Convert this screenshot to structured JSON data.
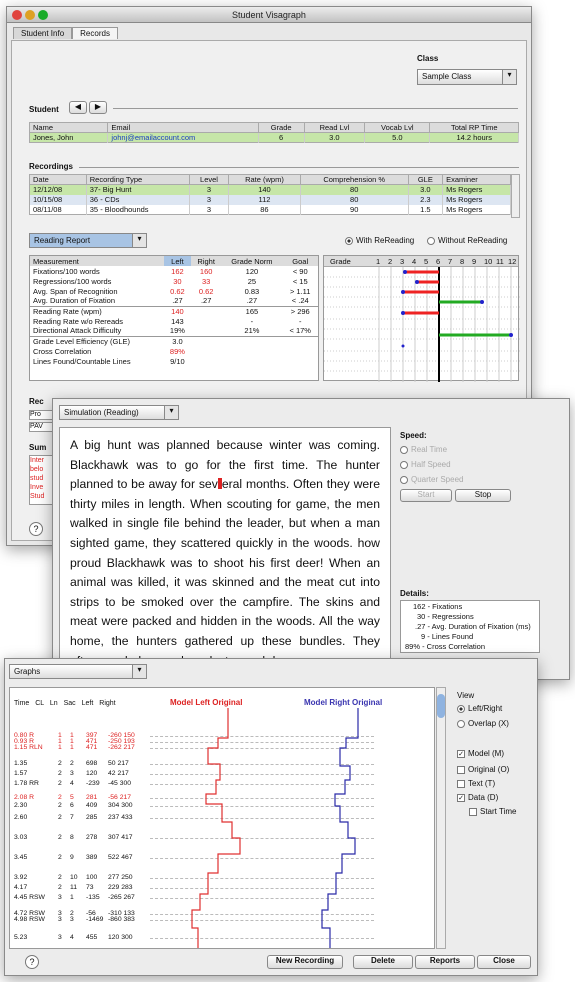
{
  "app": {
    "title": "Student Visagraph",
    "tabs": [
      "Student Info",
      "Records"
    ]
  },
  "class_section": {
    "label": "Class",
    "selected": "Sample Class"
  },
  "student": {
    "label": "Student",
    "headers": [
      "Name",
      "Email",
      "Grade",
      "Read Lvl",
      "Vocab Lvl",
      "Total RP Time"
    ],
    "row": [
      "Jones, John",
      "johnj@emailaccount.com",
      "6",
      "3.0",
      "5.0",
      "14.2 hours"
    ]
  },
  "recordings": {
    "label": "Recordings",
    "headers": [
      "Date",
      "Recording Type",
      "Level",
      "Rate (wpm)",
      "Comprehension %",
      "GLE",
      "Examiner"
    ],
    "rows": [
      [
        "12/12/08",
        "37- Big Hunt",
        "3",
        "140",
        "80",
        "3.0",
        "Ms Rogers"
      ],
      [
        "10/15/08",
        "36 - CDs",
        "3",
        "112",
        "80",
        "2.3",
        "Ms Rogers"
      ],
      [
        "08/11/08",
        "35 - Bloodhounds",
        "3",
        "86",
        "90",
        "1.5",
        "Ms Rogers"
      ]
    ]
  },
  "report": {
    "selected": "Reading Report",
    "with": "With ReReading",
    "without": "Without ReReading",
    "headers": [
      "Measurement",
      "Left",
      "Right",
      "Grade Norm",
      "Goal"
    ],
    "rows": [
      [
        "Fixations/100 words",
        "162",
        "160",
        "120",
        "< 90"
      ],
      [
        "Regressions/100 words",
        "30",
        "33",
        "25",
        "< 15"
      ],
      [
        "Avg. Span of Recognition",
        "0.62",
        "0.62",
        "0.83",
        "> 1.11"
      ],
      [
        "Avg. Duration of Fixation",
        ".27",
        ".27",
        ".27",
        "< .24"
      ]
    ],
    "rows2": [
      [
        "Reading Rate (wpm)",
        "140",
        "",
        "165",
        "> 296"
      ],
      [
        "Reading Rate w/o Rereads",
        "143",
        "",
        "-",
        "-"
      ],
      [
        "Directional Attack Difficulty",
        "19%",
        "",
        "21%",
        "< 17%"
      ]
    ],
    "rows3": [
      [
        "Grade Level Efficiency (GLE)",
        "3.0"
      ],
      [
        "Cross Correlation",
        "89%"
      ],
      [
        "Lines Found/Countable Lines",
        "9/10"
      ]
    ],
    "grade_label": "Grade",
    "grades": [
      "1",
      "2",
      "3",
      "4",
      "5",
      "6",
      "7",
      "8",
      "9",
      "10",
      "11",
      "12"
    ]
  },
  "side_labels": {
    "rec": "Rec",
    "pro": "Pro",
    "pav": "PAV",
    "sum": "Sum",
    "sum_lines": [
      "Inter",
      "belo",
      "stud",
      "Inve",
      "Stud"
    ]
  },
  "simulation": {
    "selected": "Simulation (Reading)",
    "text_before": "A big hunt was planned because winter was coming. Blackhawk was to go for the first time. The hunter planned to be away for sev",
    "text_after": "eral months. Often they were thirty miles in length. When scouting for game, the men walked in single file behind the leader, but when a man sighted game, they scattered quickly in the woods. how proud Blackhawk was to shoot his first deer! When an animal was killed, it was skinned and the meat cut into strips to be smoked over the campfire. The skins and meat were packed and hidden in the woods. All the way home, the hunters gathered up these bundles. They often needed several weeks to reach home.",
    "speed_label": "Speed:",
    "speeds": [
      "Real Time",
      "Half Speed",
      "Quarter Speed"
    ],
    "start": "Start",
    "stop": "Stop",
    "details_label": "Details:",
    "details": [
      "162 - Fixations",
      "30 - Regressions",
      ".27 - Avg. Duration of Fixation (ms)",
      "9 - Lines Found",
      "89% - Cross Correlation"
    ]
  },
  "graphs": {
    "selected": "Graphs",
    "col_headers": [
      "Time CL",
      "Ln Sac",
      "Left",
      "Right"
    ],
    "model_left": "Model Left Original",
    "model_right": "Model Right Original",
    "rows": [
      {
        "t": "0.80 R",
        "ln": "1",
        "sac": "1",
        "l": "397",
        "r": "-260 150",
        "red": true
      },
      {
        "t": "0.93 R",
        "ln": "1",
        "sac": "1",
        "l": "471",
        "r": "-250 193",
        "red": true
      },
      {
        "t": "1.15 RLN",
        "ln": "1",
        "sac": "1",
        "l": "471",
        "r": "-262 217",
        "red": true
      },
      {
        "t": "1.35",
        "ln": "2",
        "sac": "2",
        "l": "698",
        "r": "50 217",
        "red": false
      },
      {
        "t": "1.57",
        "ln": "2",
        "sac": "3",
        "l": "120",
        "r": "42 217",
        "red": false
      },
      {
        "t": "1.78 RR",
        "ln": "2",
        "sac": "4",
        "l": "-239",
        "r": "-45 300",
        "red": false
      },
      {
        "t": "2.08 R",
        "ln": "2",
        "sac": "5",
        "l": "281",
        "r": "-56 217",
        "red": true
      },
      {
        "t": "2.30",
        "ln": "2",
        "sac": "6",
        "l": "409",
        "r": "304 300",
        "red": false
      },
      {
        "t": "2.60",
        "ln": "2",
        "sac": "7",
        "l": "285",
        "r": "237 433",
        "red": false
      },
      {
        "t": "3.03",
        "ln": "2",
        "sac": "8",
        "l": "278",
        "r": "307 417",
        "red": false
      },
      {
        "t": "3.45",
        "ln": "2",
        "sac": "9",
        "l": "389",
        "r": "522 467",
        "red": false
      },
      {
        "t": "3.92",
        "ln": "2",
        "sac": "10",
        "l": "100",
        "r": "277 250",
        "red": false
      },
      {
        "t": "4.17",
        "ln": "2",
        "sac": "11",
        "l": "73",
        "r": "229 283",
        "red": false
      },
      {
        "t": "4.45 RSW",
        "ln": "3",
        "sac": "1",
        "l": "-135",
        "r": "-265 267",
        "red": false
      },
      {
        "t": "4.72 RSW",
        "ln": "3",
        "sac": "2",
        "l": "-56",
        "r": "-310 133",
        "red": false
      },
      {
        "t": "4.98 RSW",
        "ln": "3",
        "sac": "3",
        "l": "-1469",
        "r": "-860 383",
        "red": false
      },
      {
        "t": "5.23",
        "ln": "3",
        "sac": "4",
        "l": "455",
        "r": "120 300",
        "red": false
      }
    ],
    "view_label": "View",
    "views": [
      "Left/Right",
      "Overlap (X)"
    ],
    "checks": [
      {
        "label": "Model (M)",
        "on": true
      },
      {
        "label": "Original (O)",
        "on": false
      },
      {
        "label": "Text (T)",
        "on": false
      },
      {
        "label": "Data (D)",
        "on": true
      },
      {
        "label": "Start Time",
        "on": false
      }
    ]
  },
  "footer": {
    "help": "?",
    "new_recording": "New Recording",
    "delete": "Delete",
    "reports": "Reports",
    "close": "Close"
  }
}
